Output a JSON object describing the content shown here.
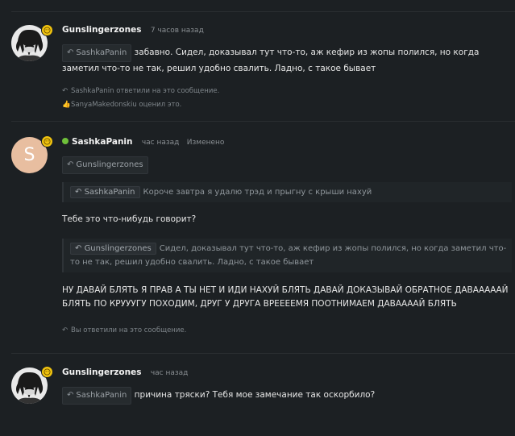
{
  "posts": [
    {
      "author": "Gunslingerzones",
      "time": "7 часов назад",
      "mention": "SashkaPanin",
      "text": "забавно. Сидел, доказывал тут что-то, аж кефир из жопы полился, но когда заметил что-то не так, решил удобно свалить. Ладно, с такое бывает",
      "activity": [
        "SashkaPanin ответили на это сообщение.",
        "SanyaMakedonskiu оценил это."
      ]
    },
    {
      "author": "SashkaPanin",
      "avatar_letter": "S",
      "time": "час назад",
      "edited": "Изменено",
      "mention": "Gunslingerzones",
      "quote1": {
        "author": "SashkaPanin",
        "text": "Короче завтра я удалю трэд и прыгну с крыши нахуй"
      },
      "text1": "Тебе это что-нибудь говорит?",
      "quote2": {
        "author": "Gunslingerzones",
        "text": "Сидел, доказывал тут что-то, аж кефир из жопы полился, но когда заметил что-то не так, решил удобно свалить. Ладно, с такое бывает"
      },
      "text2": "НУ ДАВАЙ БЛЯТЬ Я ПРАВ А ТЫ НЕТ И ИДИ НАХУЙ БЛЯТЬ ДАВАЙ ДОКАЗЫВАЙ ОБРАТНОЕ ДАВАААААЙ БЛЯТЬ ПО КРУУУГУ ПОХОДИМ, ДРУГ У ДРУГА ВРЕЕЕЕМЯ ПООТНИМАЕМ ДАВААААЙ БЛЯТЬ",
      "activity": "Вы ответили на это сообщение."
    },
    {
      "author": "Gunslingerzones",
      "time": "час назад",
      "mention": "SashkaPanin",
      "text": "причина тряски? Тебя мое замечание так оскорбило?"
    }
  ],
  "colors": {
    "online": "#6fc03a",
    "badge": "#f1c40f",
    "letter_avatar": "#e8bea0"
  }
}
